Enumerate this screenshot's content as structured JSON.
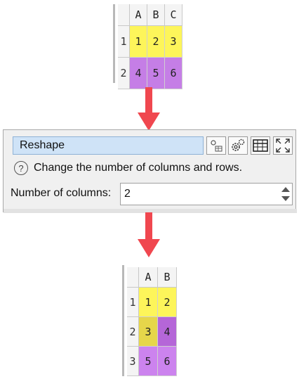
{
  "input_grid": {
    "columns": [
      "A",
      "B",
      "C"
    ],
    "rows": [
      {
        "label": "1",
        "cells": [
          "1",
          "2",
          "3"
        ]
      },
      {
        "label": "2",
        "cells": [
          "4",
          "5",
          "6"
        ]
      }
    ]
  },
  "transform": {
    "title": "Reshape",
    "help_text": "Change the number of columns and rows.",
    "columns_label": "Number of columns:",
    "columns_value": "2",
    "toolbar_icons": [
      "connections-icon",
      "settings-gear-icon",
      "data-table-icon",
      "maximize-icon"
    ]
  },
  "output_grid": {
    "columns": [
      "A",
      "B"
    ],
    "rows": [
      {
        "label": "1",
        "cells": [
          "1",
          "2"
        ]
      },
      {
        "label": "2",
        "cells": [
          "3",
          "4"
        ]
      },
      {
        "label": "3",
        "cells": [
          "5",
          "6"
        ]
      }
    ]
  },
  "colors": {
    "arrow": "#f0474f",
    "yellow": "#fdf55a",
    "purple": "#c57ee6",
    "title_bg": "#cfe3f7"
  }
}
